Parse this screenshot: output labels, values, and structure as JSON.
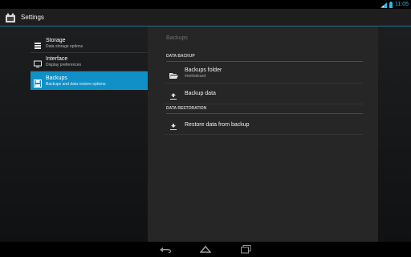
{
  "status_bar": {
    "time": "11:05",
    "icons": [
      "wifi-icon",
      "battery-icon"
    ],
    "accent": "#33b5e5"
  },
  "app": {
    "title": "Settings",
    "icon": "settings-app-icon"
  },
  "headers": [
    {
      "icon": "storage-icon",
      "title": "Storage",
      "summary": "Data storage options",
      "selected": false
    },
    {
      "icon": "monitor-icon",
      "title": "Interface",
      "summary": "Display preferences",
      "selected": false
    },
    {
      "icon": "save-icon",
      "title": "Backups",
      "summary": "Backups and data restore options",
      "selected": true
    }
  ],
  "detail": {
    "breadcrumb": "Backups",
    "categories": [
      {
        "title": "DATA BACKUP",
        "items": [
          {
            "icon": "folder-open-icon",
            "title": "Backups folder",
            "summary": "/mnt/sdcard"
          },
          {
            "icon": "upload-icon",
            "title": "Backup data",
            "summary": ""
          }
        ]
      },
      {
        "title": "DATA RESTORATION",
        "items": [
          {
            "icon": "download-icon",
            "title": "Restore data from backup",
            "summary": ""
          }
        ]
      }
    ]
  },
  "nav": [
    "back-icon",
    "home-icon",
    "recents-icon"
  ],
  "colors": {
    "selected": "#0f90c6",
    "action_bar": "#1e1e1e",
    "detail_bg": "#262626"
  }
}
